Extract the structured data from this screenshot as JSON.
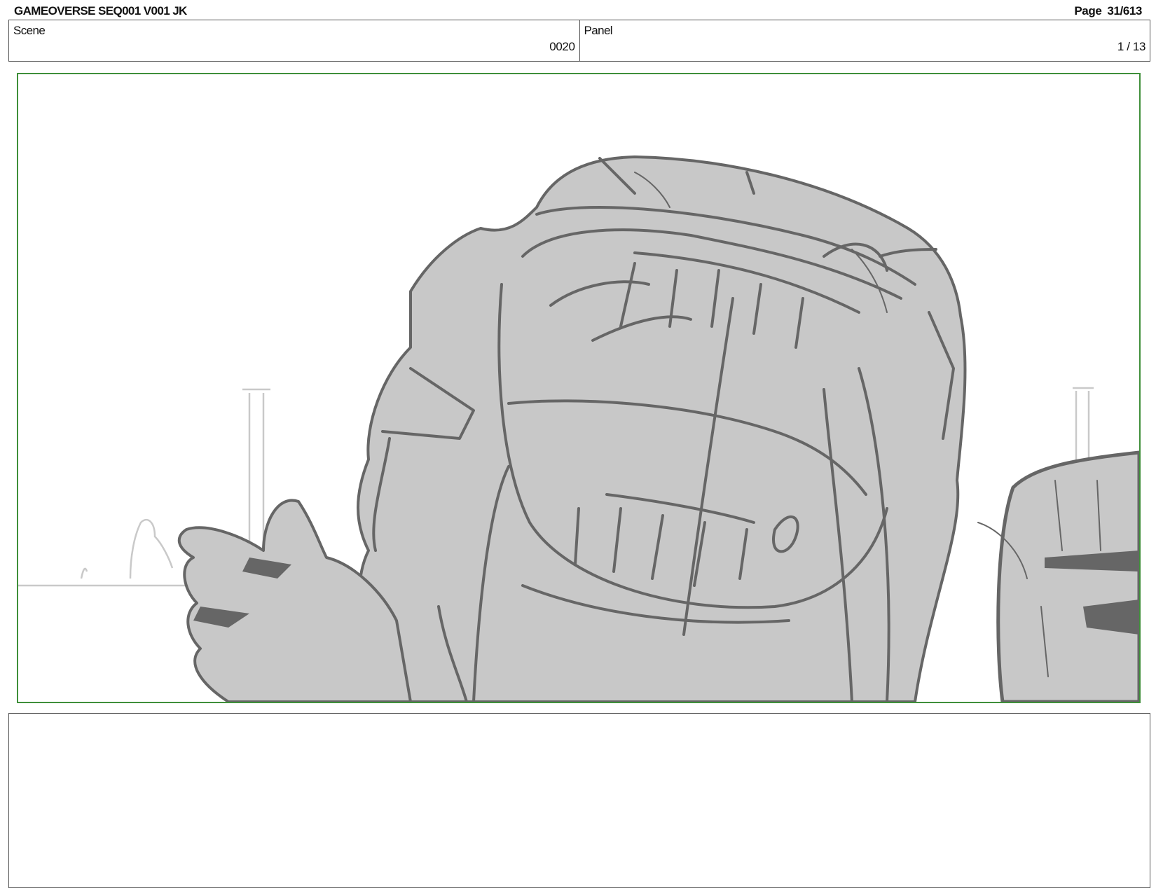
{
  "header": {
    "title": "GAMEOVERSE SEQ001 V001 JK",
    "page_label": "Page",
    "page_value": "31/613"
  },
  "info": {
    "scene_label": "Scene",
    "scene_value": "0020",
    "panel_label": "Panel",
    "panel_value": "1 / 13"
  },
  "panel": {
    "frame_color": "#3f8f3a",
    "sketch_fill": "#c8c8c8",
    "sketch_line": "#666666"
  }
}
